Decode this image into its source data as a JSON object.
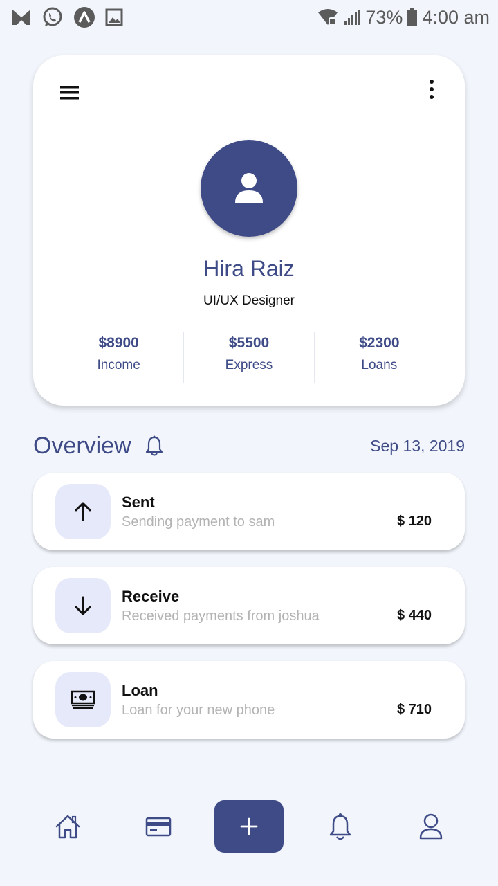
{
  "status_bar": {
    "battery": "73%",
    "time": "4:00 am",
    "left_icons": [
      "mail-icon",
      "whatsapp-icon",
      "app-icon",
      "gallery-icon"
    ],
    "right_icons": [
      "wifi-icon",
      "signal-icon",
      "battery-icon"
    ]
  },
  "profile": {
    "name": "Hira Raiz",
    "role": "UI/UX Designer",
    "stats": [
      {
        "value": "$8900",
        "label": "Income"
      },
      {
        "value": "$5500",
        "label": "Express"
      },
      {
        "value": "$2300",
        "label": "Loans"
      }
    ]
  },
  "overview": {
    "title": "Overview",
    "date": "Sep 13, 2019"
  },
  "transactions": [
    {
      "title": "Sent",
      "subtitle": "Sending payment to sam",
      "amount": "$ 120",
      "icon": "arrow-up-icon"
    },
    {
      "title": "Receive",
      "subtitle": "Received payments from joshua",
      "amount": "$ 440",
      "icon": "arrow-down-icon"
    },
    {
      "title": "Loan",
      "subtitle": "Loan for your new phone",
      "amount": "$ 710",
      "icon": "money-icon"
    }
  ],
  "bottom_nav": {
    "items": [
      "home-icon",
      "card-icon",
      "plus-icon",
      "bell-icon",
      "user-icon"
    ]
  },
  "colors": {
    "primary": "#3e4b87",
    "background": "#f2f6fc",
    "icon_tile": "#e6e9fa",
    "muted_text": "#b3b3b3"
  }
}
